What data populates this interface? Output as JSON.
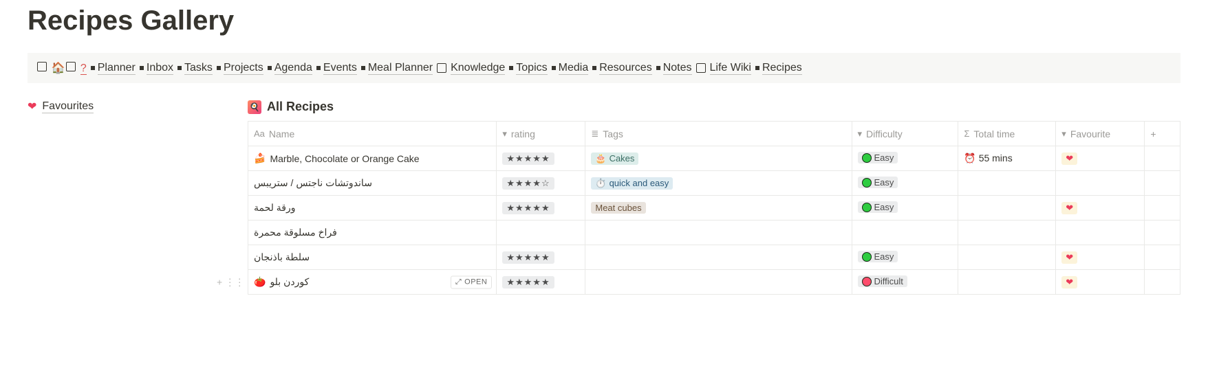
{
  "page": {
    "title": "Recipes Gallery"
  },
  "nav": {
    "home_emoji": "🏠",
    "question": "?",
    "items": [
      {
        "label": "Planner"
      },
      {
        "label": "Inbox"
      },
      {
        "label": "Tasks"
      },
      {
        "label": "Projects"
      },
      {
        "label": "Agenda"
      },
      {
        "label": "Events"
      },
      {
        "label": "Meal Planner"
      },
      {
        "label": "Knowledge",
        "boxed": true
      },
      {
        "label": "Topics"
      },
      {
        "label": "Media"
      },
      {
        "label": "Resources"
      },
      {
        "label": "Notes"
      },
      {
        "label": "Life Wiki",
        "boxed": true
      },
      {
        "label": "Recipes"
      }
    ]
  },
  "sidebar": {
    "favourites_label": "Favourites"
  },
  "view": {
    "title": "All Recipes"
  },
  "columns": {
    "name": "Name",
    "rating": "rating",
    "tags": "Tags",
    "difficulty": "Difficulty",
    "total_time": "Total time",
    "favourite": "Favourite"
  },
  "open_label": "OPEN",
  "rows": [
    {
      "emoji": "🍰",
      "name": "Marble, Chocolate or Orange Cake",
      "rating": "★★★★★",
      "tags": [
        {
          "emoji": "🎂",
          "label": "Cakes",
          "color": "teal"
        }
      ],
      "difficulty": {
        "label": "Easy",
        "color": "green"
      },
      "total_time": "55 mins",
      "time_emoji": "⏰",
      "favourite": true
    },
    {
      "emoji": "",
      "name": "ساندوتشات ناجتس / ستريبس",
      "rating": "★★★★☆",
      "tags": [
        {
          "emoji": "⏱️",
          "label": "quick and easy",
          "color": "blue"
        }
      ],
      "difficulty": {
        "label": "Easy",
        "color": "green"
      },
      "total_time": "",
      "favourite": false
    },
    {
      "emoji": "",
      "name": "ورقة لحمة",
      "rating": "★★★★★",
      "tags": [
        {
          "emoji": "",
          "label": "Meat cubes",
          "color": "brown"
        }
      ],
      "difficulty": {
        "label": "Easy",
        "color": "green"
      },
      "total_time": "",
      "favourite": true
    },
    {
      "emoji": "",
      "name": "فراخ مسلوقة محمرة",
      "rating": "",
      "tags": [],
      "difficulty": null,
      "total_time": "",
      "favourite": false
    },
    {
      "emoji": "",
      "name": "سلطة باذنجان",
      "rating": "★★★★★",
      "tags": [],
      "difficulty": {
        "label": "Easy",
        "color": "green"
      },
      "total_time": "",
      "favourite": true
    },
    {
      "emoji": "🍅",
      "name": "كوردن بلو",
      "rating": "★★★★★",
      "tags": [],
      "difficulty": {
        "label": "Difficult",
        "color": "red"
      },
      "total_time": "",
      "favourite": true,
      "hover": true
    }
  ]
}
